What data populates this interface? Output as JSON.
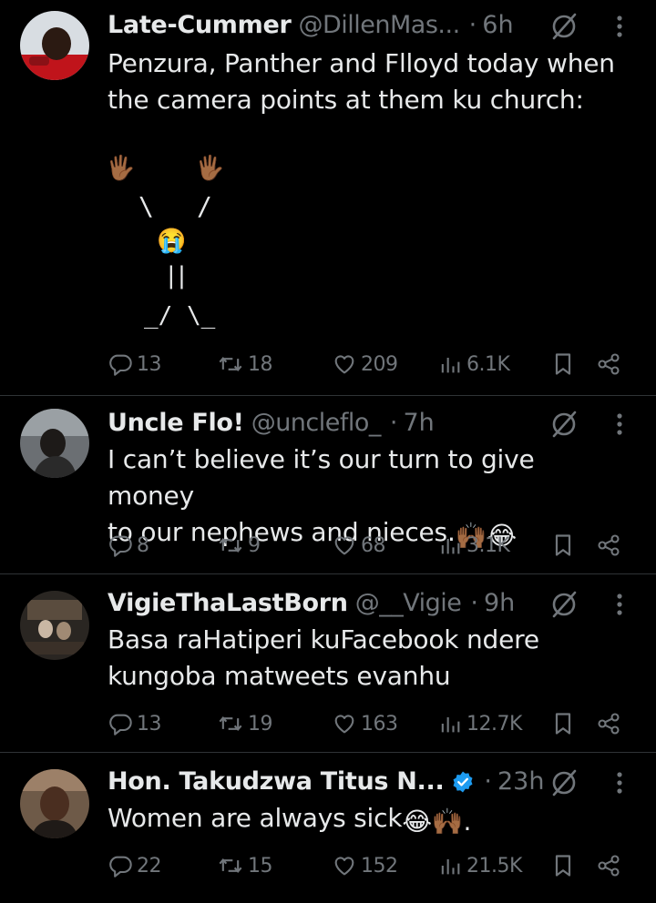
{
  "colors": {
    "background": "#000000",
    "text_primary": "#e7e9ea",
    "text_secondary": "#71767b",
    "verified_blue": "#1d9bf0",
    "divider": "#2f3336"
  },
  "tweets": [
    {
      "name": "Late-Cummer",
      "handle": "@DillenMas...",
      "separator": "·",
      "time": "6h",
      "text_line1": "Penzura, Panther and Flloyd today when",
      "text_line2": "the camera points at them ku church:",
      "ascii_art": {
        "hands": "🖐🏾",
        "arms_left": "\\",
        "arms_right": "/",
        "face": "😭",
        "body": "||",
        "legs": "_/ \\_"
      },
      "replies": "13",
      "reposts": "18",
      "likes": "209",
      "views": "6.1K"
    },
    {
      "name": "Uncle Flo!",
      "handle": "@uncleflo_",
      "separator": "·",
      "time": "7h",
      "text_line1": "I can’t believe it’s our turn to give money",
      "text_line2": "to our nephews and nieces.",
      "emoji_suffix": "🙌🏾😂",
      "replies": "8",
      "reposts": "9",
      "likes": "68",
      "views": "3.1K"
    },
    {
      "name": "VigieThaLastBorn",
      "handle": "@__Vigie",
      "separator": "·",
      "time": "9h",
      "text_line1": "Basa raHatiperi kuFacebook ndere",
      "text_line2": "kungoba matweets evanhu",
      "replies": "13",
      "reposts": "19",
      "likes": "163",
      "views": "12.7K"
    },
    {
      "name": "Hon. Takudzwa Titus N...",
      "verified": true,
      "separator": "·",
      "time": "23h",
      "text_line1": "Women are always sick",
      "emoji_suffix": "😂🙌🏾.",
      "replies": "22",
      "reposts": "15",
      "likes": "152",
      "views": "21.5K"
    }
  ],
  "icons": {
    "reply": "reply-icon",
    "repost": "repost-icon",
    "like": "like-icon",
    "views": "views-icon",
    "bookmark": "bookmark-icon",
    "share": "share-icon",
    "grok": "grok-icon",
    "more": "more-icon"
  }
}
